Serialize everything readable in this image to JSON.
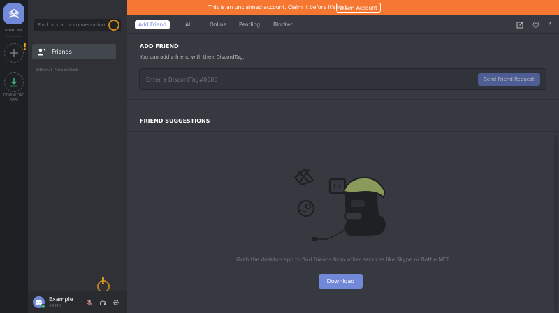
{
  "rail": {
    "online_label": "0 ONLINE",
    "download_label_1": "DOWNLOAD",
    "download_label_2": "APPS",
    "badge": "!"
  },
  "sidebar": {
    "search_placeholder": "Find or start a conversation",
    "friends_label": "Friends",
    "dm_header": "DIRECT MESSAGES"
  },
  "user": {
    "name": "Example",
    "discriminator": "#5340",
    "badge": "!"
  },
  "banner": {
    "text": "This is an unclaimed account. Claim it before it's lost.",
    "button": "Claim Account"
  },
  "tabs": {
    "add_friend": "Add Friend",
    "all": "All",
    "online": "Online",
    "pending": "Pending",
    "blocked": "Blocked"
  },
  "topbar_icons": [
    "new-group-dm-icon",
    "mention-icon",
    "help-icon"
  ],
  "help_glyph": "?",
  "mention_glyph": "@",
  "add_friend": {
    "title": "ADD FRIEND",
    "subtitle": "You can add a friend with their DiscordTag.",
    "placeholder": "Enter a DiscordTag#0000",
    "button": "Send Friend Request"
  },
  "suggestions": {
    "title": "FRIEND SUGGESTIONS",
    "text": "Grab the desktop app to find friends from other services like Skype or Battle.NET.",
    "button": "Download"
  },
  "colors": {
    "blurple": "#7289da",
    "banner": "#f57731",
    "highlight": "#faa61a",
    "online": "#43b581"
  }
}
